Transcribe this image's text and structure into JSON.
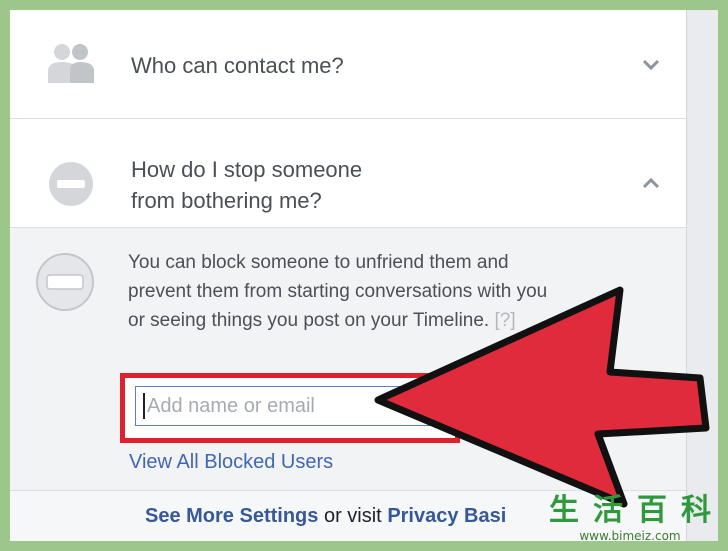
{
  "sections": {
    "contact": {
      "title": "Who can contact me?"
    },
    "stop": {
      "title_line1": "How do I stop someone",
      "title_line2": "from bothering me?"
    }
  },
  "block": {
    "description": "You can block someone to unfriend them and prevent them from starting conversations with you or seeing things you post on your Timeline.",
    "help": "[?]",
    "input_placeholder": "Add name or email",
    "view_blocked_link": "View All Blocked Users"
  },
  "footer": {
    "see_more": "See More Settings",
    "or_visit": "or visit",
    "privacy": "Privacy Basi"
  },
  "watermark": {
    "chars": [
      "生",
      "活",
      "百",
      "科"
    ],
    "url": "www.bimeiz.com"
  },
  "colors": {
    "arrow_fill": "#e02b3c",
    "highlight_border": "#e0202e",
    "link": "#4267b2",
    "frame_bg": "#9cc68a"
  }
}
